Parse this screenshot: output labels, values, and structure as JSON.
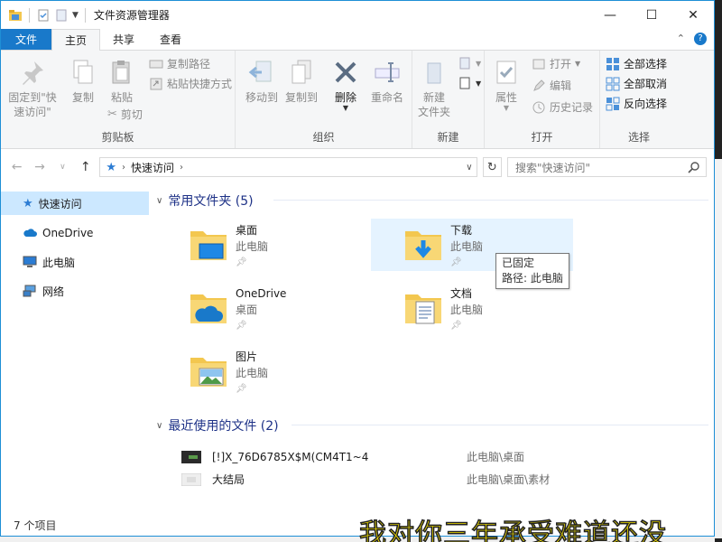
{
  "window": {
    "title": "文件资源管理器",
    "controls": {
      "minimize": "—",
      "maximize": "☐",
      "close": "✕"
    }
  },
  "ribbon_tabs": [
    {
      "label": "文件"
    },
    {
      "label": "主页"
    },
    {
      "label": "共享"
    },
    {
      "label": "查看"
    }
  ],
  "ribbon": {
    "clipboard": {
      "label": "剪贴板",
      "pin_quick_access": "固定到\"快\n速访问\"",
      "copy": "复制",
      "paste": "粘贴",
      "copy_path": "复制路径",
      "paste_shortcut": "粘贴快捷方式",
      "cut": "剪切"
    },
    "organize": {
      "label": "组织",
      "move_to": "移动到",
      "copy_to": "复制到",
      "delete": "删除",
      "rename": "重命名"
    },
    "new": {
      "label": "新建",
      "new_folder": "新建\n文件夹"
    },
    "open": {
      "label": "打开",
      "properties": "属性",
      "open": "打开",
      "edit": "编辑",
      "history": "历史记录"
    },
    "select": {
      "label": "选择",
      "select_all": "全部选择",
      "select_none": "全部取消",
      "invert": "反向选择"
    }
  },
  "address": {
    "current": "快速访问",
    "search_placeholder": "搜索\"快速访问\""
  },
  "nav": [
    {
      "label": "快速访问",
      "icon": "star-icon"
    },
    {
      "label": "OneDrive",
      "icon": "cloud-icon"
    },
    {
      "label": "此电脑",
      "icon": "computer-icon"
    },
    {
      "label": "网络",
      "icon": "network-icon"
    }
  ],
  "groups": {
    "frequent": "常用文件夹 (5)",
    "recent": "最近使用的文件 (2)"
  },
  "folders": [
    {
      "name": "桌面",
      "location": "此电脑",
      "icon": "desktop-folder-icon"
    },
    {
      "name": "下载",
      "location": "此电脑",
      "icon": "downloads-folder-icon"
    },
    {
      "name": "OneDrive",
      "location": "桌面",
      "icon": "onedrive-folder-icon"
    },
    {
      "name": "文档",
      "location": "此电脑",
      "icon": "documents-folder-icon"
    },
    {
      "name": "图片",
      "location": "此电脑",
      "icon": "pictures-folder-icon"
    }
  ],
  "tooltip": {
    "line1": "已固定",
    "line2": "路径: 此电脑"
  },
  "recent_files": [
    {
      "name": "[!]X_76D6785X$M(CM4T1~4",
      "path": "此电脑\\桌面"
    },
    {
      "name": "大结局",
      "path": "此电脑\\桌面\\素材"
    }
  ],
  "status": {
    "items": "7 个项目"
  },
  "overlay_caption": "我对你三年承受难道还没",
  "colors": {
    "accent": "#1979ca",
    "hover": "#e5f3ff",
    "selected": "#cce8ff",
    "group_header": "#1e3287"
  }
}
